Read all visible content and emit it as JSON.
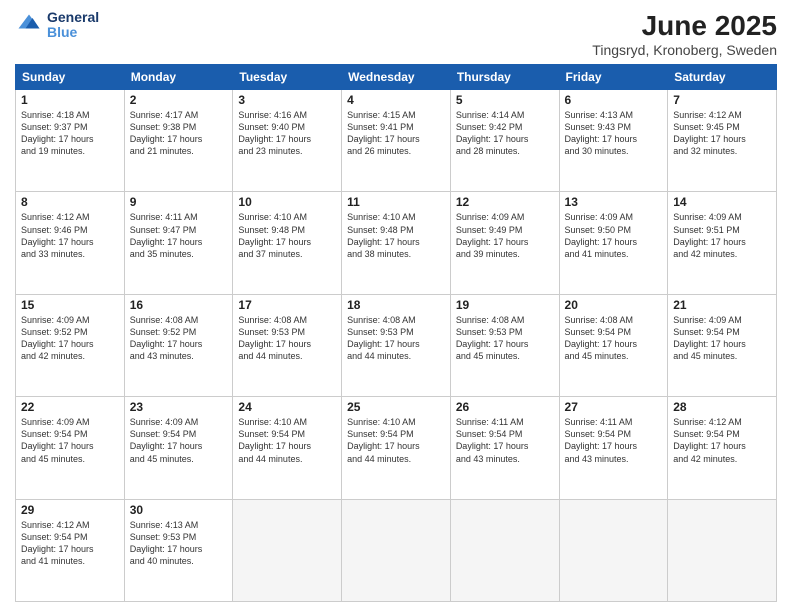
{
  "header": {
    "logo_line1": "General",
    "logo_line2": "Blue",
    "title": "June 2025",
    "subtitle": "Tingsryd, Kronoberg, Sweden"
  },
  "days_of_week": [
    "Sunday",
    "Monday",
    "Tuesday",
    "Wednesday",
    "Thursday",
    "Friday",
    "Saturday"
  ],
  "weeks": [
    [
      {
        "day": "1",
        "info": "Sunrise: 4:18 AM\nSunset: 9:37 PM\nDaylight: 17 hours\nand 19 minutes."
      },
      {
        "day": "2",
        "info": "Sunrise: 4:17 AM\nSunset: 9:38 PM\nDaylight: 17 hours\nand 21 minutes."
      },
      {
        "day": "3",
        "info": "Sunrise: 4:16 AM\nSunset: 9:40 PM\nDaylight: 17 hours\nand 23 minutes."
      },
      {
        "day": "4",
        "info": "Sunrise: 4:15 AM\nSunset: 9:41 PM\nDaylight: 17 hours\nand 26 minutes."
      },
      {
        "day": "5",
        "info": "Sunrise: 4:14 AM\nSunset: 9:42 PM\nDaylight: 17 hours\nand 28 minutes."
      },
      {
        "day": "6",
        "info": "Sunrise: 4:13 AM\nSunset: 9:43 PM\nDaylight: 17 hours\nand 30 minutes."
      },
      {
        "day": "7",
        "info": "Sunrise: 4:12 AM\nSunset: 9:45 PM\nDaylight: 17 hours\nand 32 minutes."
      }
    ],
    [
      {
        "day": "8",
        "info": "Sunrise: 4:12 AM\nSunset: 9:46 PM\nDaylight: 17 hours\nand 33 minutes."
      },
      {
        "day": "9",
        "info": "Sunrise: 4:11 AM\nSunset: 9:47 PM\nDaylight: 17 hours\nand 35 minutes."
      },
      {
        "day": "10",
        "info": "Sunrise: 4:10 AM\nSunset: 9:48 PM\nDaylight: 17 hours\nand 37 minutes."
      },
      {
        "day": "11",
        "info": "Sunrise: 4:10 AM\nSunset: 9:48 PM\nDaylight: 17 hours\nand 38 minutes."
      },
      {
        "day": "12",
        "info": "Sunrise: 4:09 AM\nSunset: 9:49 PM\nDaylight: 17 hours\nand 39 minutes."
      },
      {
        "day": "13",
        "info": "Sunrise: 4:09 AM\nSunset: 9:50 PM\nDaylight: 17 hours\nand 41 minutes."
      },
      {
        "day": "14",
        "info": "Sunrise: 4:09 AM\nSunset: 9:51 PM\nDaylight: 17 hours\nand 42 minutes."
      }
    ],
    [
      {
        "day": "15",
        "info": "Sunrise: 4:09 AM\nSunset: 9:52 PM\nDaylight: 17 hours\nand 42 minutes."
      },
      {
        "day": "16",
        "info": "Sunrise: 4:08 AM\nSunset: 9:52 PM\nDaylight: 17 hours\nand 43 minutes."
      },
      {
        "day": "17",
        "info": "Sunrise: 4:08 AM\nSunset: 9:53 PM\nDaylight: 17 hours\nand 44 minutes."
      },
      {
        "day": "18",
        "info": "Sunrise: 4:08 AM\nSunset: 9:53 PM\nDaylight: 17 hours\nand 44 minutes."
      },
      {
        "day": "19",
        "info": "Sunrise: 4:08 AM\nSunset: 9:53 PM\nDaylight: 17 hours\nand 45 minutes."
      },
      {
        "day": "20",
        "info": "Sunrise: 4:08 AM\nSunset: 9:54 PM\nDaylight: 17 hours\nand 45 minutes."
      },
      {
        "day": "21",
        "info": "Sunrise: 4:09 AM\nSunset: 9:54 PM\nDaylight: 17 hours\nand 45 minutes."
      }
    ],
    [
      {
        "day": "22",
        "info": "Sunrise: 4:09 AM\nSunset: 9:54 PM\nDaylight: 17 hours\nand 45 minutes."
      },
      {
        "day": "23",
        "info": "Sunrise: 4:09 AM\nSunset: 9:54 PM\nDaylight: 17 hours\nand 45 minutes."
      },
      {
        "day": "24",
        "info": "Sunrise: 4:10 AM\nSunset: 9:54 PM\nDaylight: 17 hours\nand 44 minutes."
      },
      {
        "day": "25",
        "info": "Sunrise: 4:10 AM\nSunset: 9:54 PM\nDaylight: 17 hours\nand 44 minutes."
      },
      {
        "day": "26",
        "info": "Sunrise: 4:11 AM\nSunset: 9:54 PM\nDaylight: 17 hours\nand 43 minutes."
      },
      {
        "day": "27",
        "info": "Sunrise: 4:11 AM\nSunset: 9:54 PM\nDaylight: 17 hours\nand 43 minutes."
      },
      {
        "day": "28",
        "info": "Sunrise: 4:12 AM\nSunset: 9:54 PM\nDaylight: 17 hours\nand 42 minutes."
      }
    ],
    [
      {
        "day": "29",
        "info": "Sunrise: 4:12 AM\nSunset: 9:54 PM\nDaylight: 17 hours\nand 41 minutes."
      },
      {
        "day": "30",
        "info": "Sunrise: 4:13 AM\nSunset: 9:53 PM\nDaylight: 17 hours\nand 40 minutes."
      },
      {
        "day": "",
        "info": ""
      },
      {
        "day": "",
        "info": ""
      },
      {
        "day": "",
        "info": ""
      },
      {
        "day": "",
        "info": ""
      },
      {
        "day": "",
        "info": ""
      }
    ]
  ]
}
